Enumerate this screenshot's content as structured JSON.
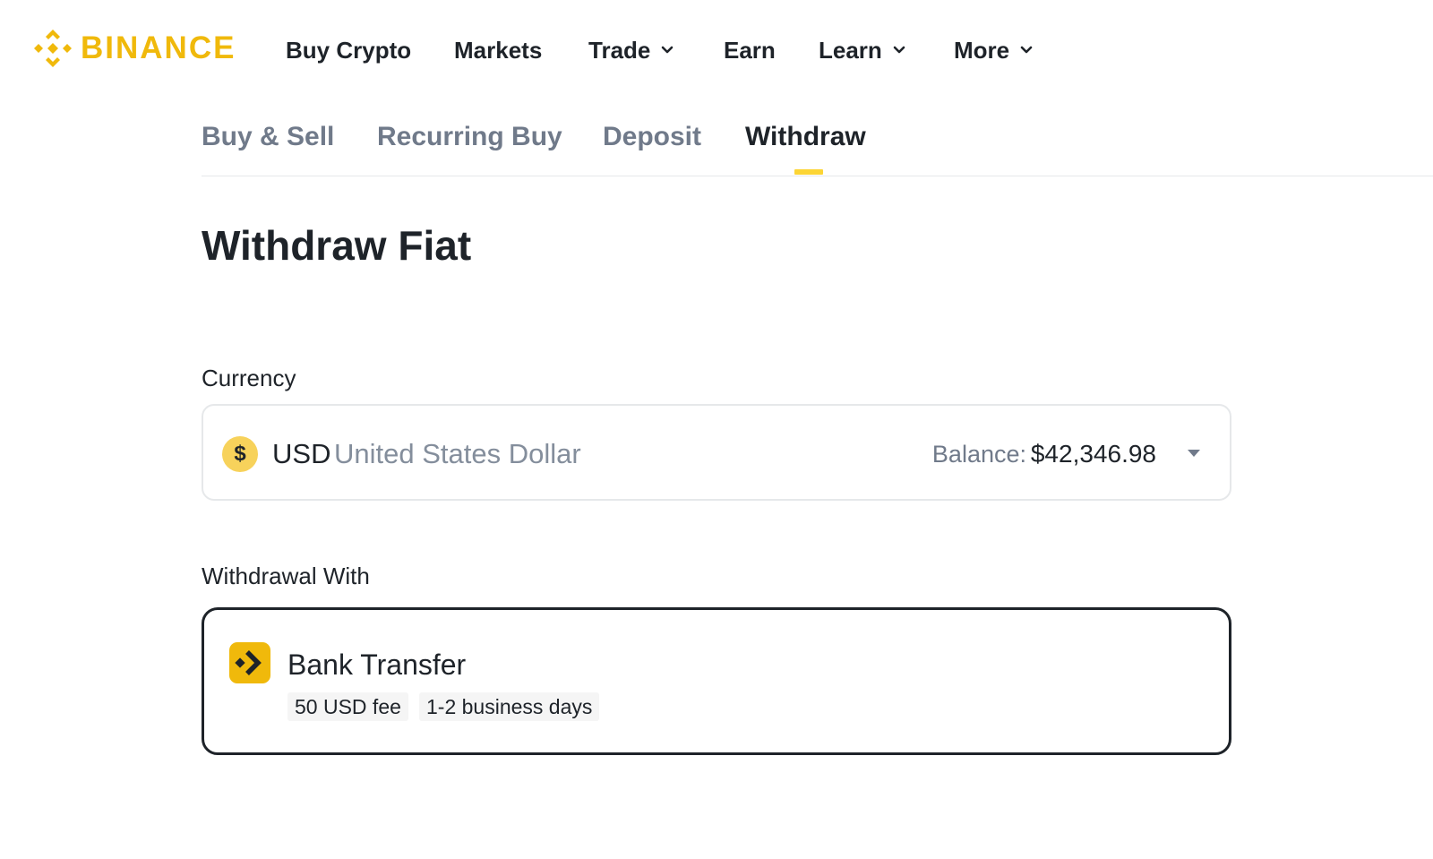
{
  "brand": {
    "name": "BINANCE",
    "color": "#f0b90b"
  },
  "nav": {
    "items": [
      {
        "label": "Buy Crypto",
        "has_dropdown": false
      },
      {
        "label": "Markets",
        "has_dropdown": false
      },
      {
        "label": "Trade",
        "has_dropdown": true
      },
      {
        "label": "Earn",
        "has_dropdown": false
      },
      {
        "label": "Learn",
        "has_dropdown": true
      },
      {
        "label": "More",
        "has_dropdown": true
      }
    ]
  },
  "tabs": [
    {
      "label": "Buy & Sell",
      "active": false
    },
    {
      "label": "Recurring Buy",
      "active": false
    },
    {
      "label": "Deposit",
      "active": false
    },
    {
      "label": "Withdraw",
      "active": true
    }
  ],
  "page": {
    "title": "Withdraw Fiat"
  },
  "currency": {
    "label": "Currency",
    "symbol": "$",
    "code": "USD",
    "name": "United States Dollar",
    "balance_label": "Balance:",
    "balance_value": "$42,346.98",
    "icon": "dollar-coin-icon"
  },
  "withdrawal": {
    "label": "Withdrawal With",
    "method": {
      "name": "Bank Transfer",
      "icon": "bank-transfer-icon",
      "tags": [
        "50 USD fee",
        "1-2 business days"
      ]
    }
  },
  "colors": {
    "accent": "#fcd535",
    "text_primary": "#1e2329",
    "text_secondary": "#707a8a",
    "border": "#e6e8ea"
  }
}
